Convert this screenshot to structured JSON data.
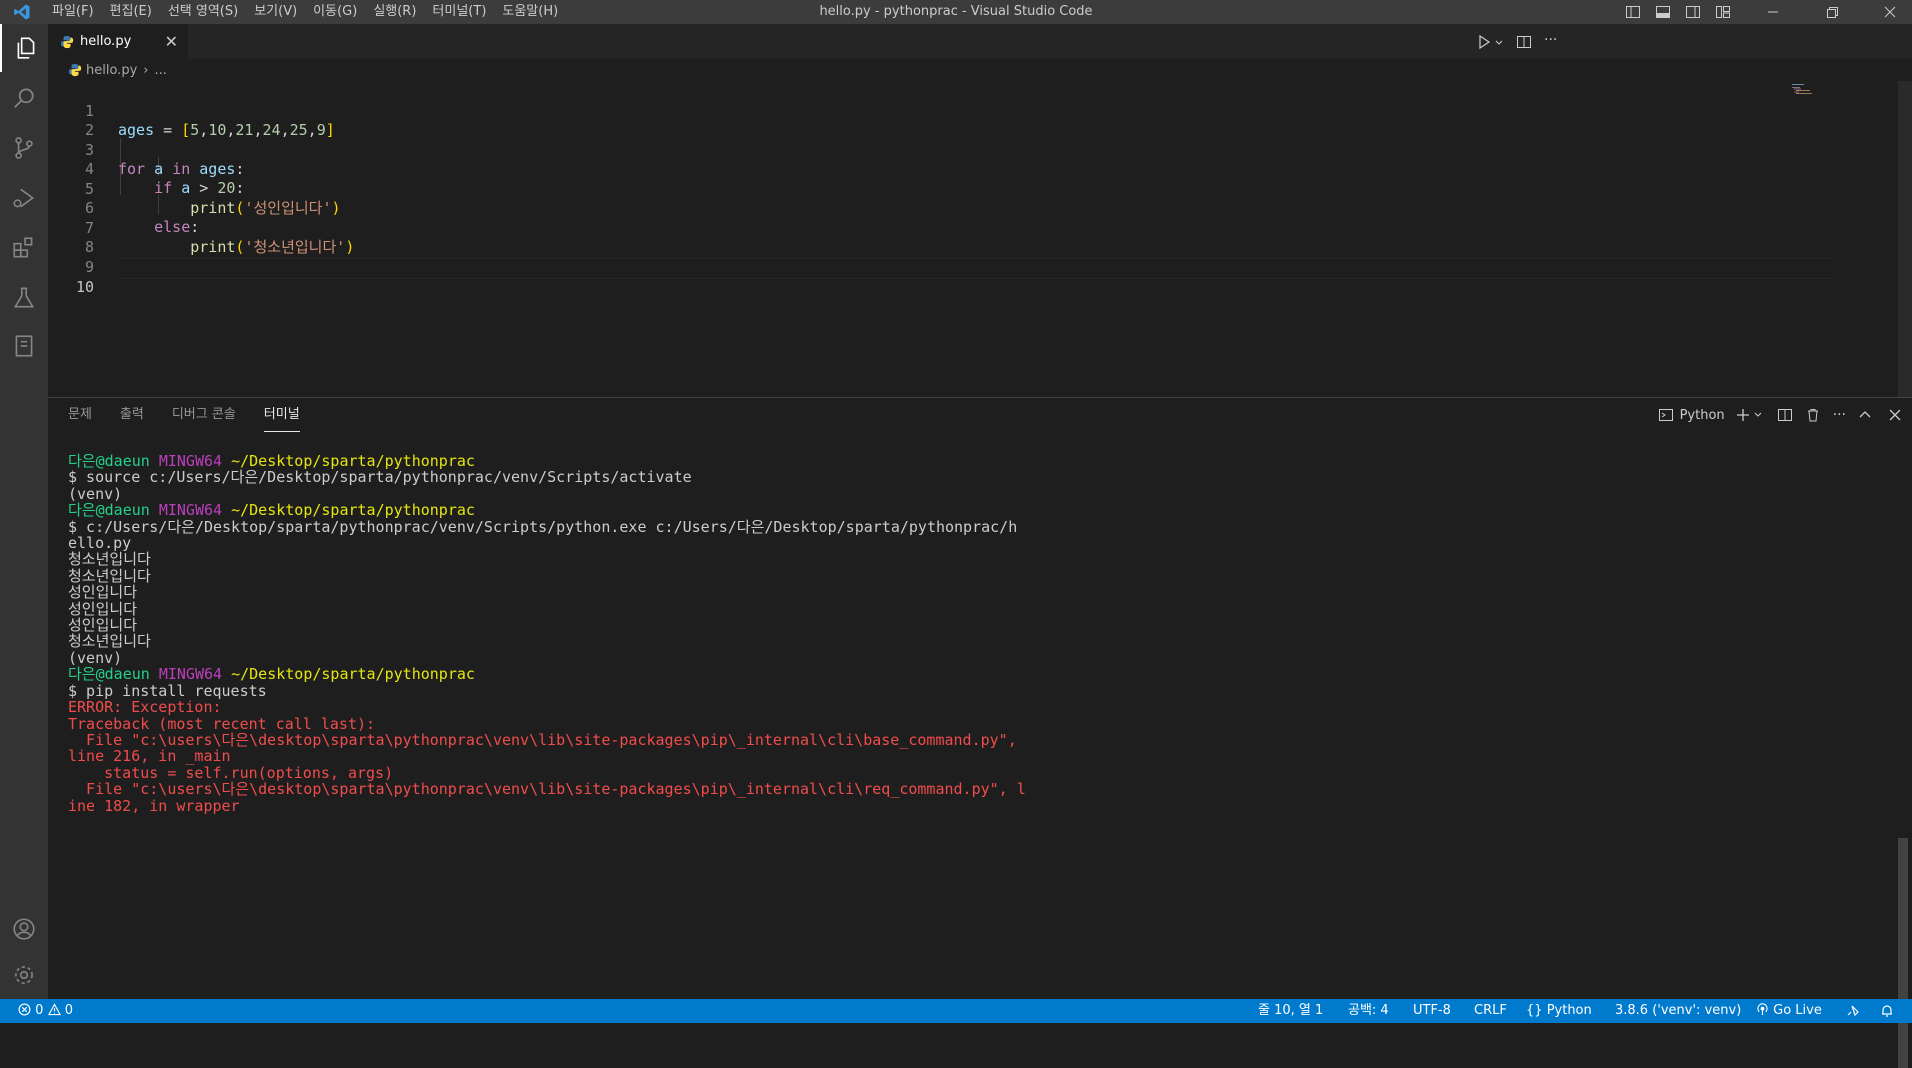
{
  "titlebar": {
    "menus": [
      "파일(F)",
      "편집(E)",
      "선택 영역(S)",
      "보기(V)",
      "이동(G)",
      "실행(R)",
      "터미널(T)",
      "도움말(H)"
    ],
    "window_title": "hello.py - pythonprac - Visual Studio Code"
  },
  "tab": {
    "filename": "hello.py",
    "close": "✕"
  },
  "breadcrumb": {
    "file": "hello.py",
    "sep": "›",
    "rest": "..."
  },
  "editor": {
    "line_numbers": [
      "1",
      "2",
      "3",
      "4",
      "5",
      "6",
      "7",
      "8",
      "9",
      "10"
    ],
    "lines": [
      "ages = [5,10,21,24,25,9]",
      "",
      "for a in ages:",
      "    if a > 20:",
      "        print('성인입니다')",
      "    else:",
      "        print('청소년입니다')",
      "",
      "",
      ""
    ]
  },
  "panel": {
    "tabs": [
      "문제",
      "출력",
      "디버그 콘솔",
      "터미널"
    ],
    "active_tab": "터미널",
    "terminal_profile": "Python"
  },
  "terminal": {
    "prompt_user": "다은@daeun",
    "prompt_host": "MINGW64",
    "prompt_path": "~/Desktop/sparta/pythonprac",
    "cmd_activate": "$ source c:/Users/다은/Desktop/sparta/pythonprac/venv/Scripts/activate",
    "venv": "(venv)",
    "cmd_python_1": "$ c:/Users/다은/Desktop/sparta/pythonprac/venv/Scripts/python.exe c:/Users/다은/Desktop/sparta/pythonprac/h",
    "cmd_python_2": "ello.py",
    "out": [
      "청소년입니다",
      "청소년입니다",
      "성인입니다",
      "성인입니다",
      "성인입니다",
      "청소년입니다"
    ],
    "cmd_pip": "$ pip install requests",
    "errors": [
      "ERROR: Exception:",
      "Traceback (most recent call last):",
      "  File \"c:\\users\\다은\\desktop\\sparta\\pythonprac\\venv\\lib\\site-packages\\pip\\_internal\\cli\\base_command.py\",",
      "line 216, in _main",
      "    status = self.run(options, args)",
      "  File \"c:\\users\\다은\\desktop\\sparta\\pythonprac\\venv\\lib\\site-packages\\pip\\_internal\\cli\\req_command.py\", l",
      "ine 182, in wrapper"
    ]
  },
  "statusbar": {
    "errors": "0",
    "warnings": "0",
    "position": "줄 10, 열 1",
    "indent": "공백: 4",
    "encoding": "UTF-8",
    "eol": "CRLF",
    "language": "Python",
    "interpreter": "3.8.6 ('venv': venv)",
    "golive": "Go Live"
  },
  "colors": {
    "accent": "#007acc",
    "activity_bar": "#333333",
    "editor_bg": "#1e1e1e",
    "error_text": "#f14c4c"
  }
}
